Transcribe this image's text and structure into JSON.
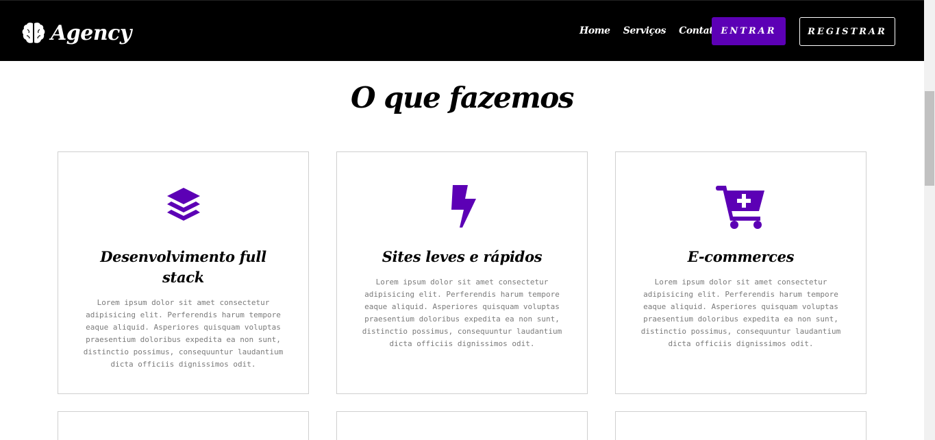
{
  "navbar": {
    "brand": "Agency",
    "links": [
      "Home",
      "Serviços",
      "Contato"
    ],
    "entrar_label": "ENTRAR",
    "registrar_label": "REGISTRAR"
  },
  "colors": {
    "accent": "#5c00b5",
    "navbar_bg": "#000000",
    "text_muted": "#7a7a7a"
  },
  "section": {
    "title": "O que fazemos"
  },
  "services": [
    {
      "icon": "layers-icon",
      "title": "Desenvolvimento full stack",
      "text": "Lorem ipsum dolor sit amet consectetur adipisicing elit. Perferendis harum tempore eaque aliquid. Asperiores quisquam voluptas praesentium doloribus expedita ea non sunt, distinctio possimus, consequuntur laudantium dicta officiis dignissimos odit."
    },
    {
      "icon": "bolt-icon",
      "title": "Sites leves e rápidos",
      "text": "Lorem ipsum dolor sit amet consectetur adipisicing elit. Perferendis harum tempore eaque aliquid. Asperiores quisquam voluptas praesentium doloribus expedita ea non sunt, distinctio possimus, consequuntur laudantium dicta officiis dignissimos odit."
    },
    {
      "icon": "cart-plus-icon",
      "title": "E-commerces",
      "text": "Lorem ipsum dolor sit amet consectetur adipisicing elit. Perferendis harum tempore eaque aliquid. Asperiores quisquam voluptas praesentium doloribus expedita ea non sunt, distinctio possimus, consequuntur laudantium dicta officiis dignissimos odit."
    }
  ]
}
